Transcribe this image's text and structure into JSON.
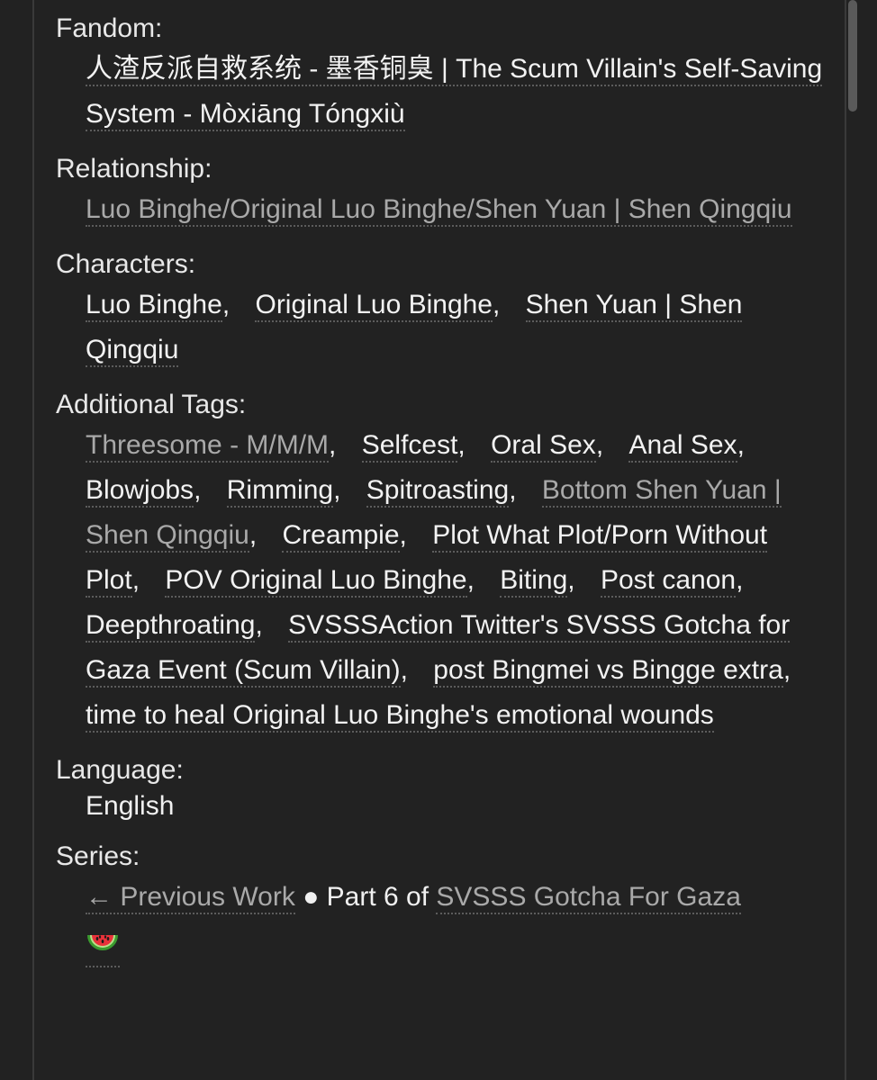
{
  "fandom": {
    "label": "Fandom:",
    "tags": [
      {
        "text": "人渣反派自救系统 - 墨香铜臭 | The Scum Villain's Self-Saving System - Mòxiāng Tóngxiù",
        "dim": false
      }
    ]
  },
  "relationship": {
    "label": "Relationship:",
    "tags": [
      {
        "text": "Luo Binghe/Original Luo Binghe/Shen Yuan | Shen Qingqiu",
        "dim": true
      }
    ]
  },
  "characters": {
    "label": "Characters:",
    "tags": [
      {
        "text": "Luo Binghe",
        "dim": false
      },
      {
        "text": "Original Luo Binghe",
        "dim": false
      },
      {
        "text": "Shen Yuan | Shen Qingqiu",
        "dim": false
      }
    ]
  },
  "additional_tags": {
    "label": "Additional Tags:",
    "tags": [
      {
        "text": "Threesome - M/M/M",
        "dim": true
      },
      {
        "text": "Selfcest",
        "dim": false
      },
      {
        "text": "Oral Sex",
        "dim": false
      },
      {
        "text": "Anal Sex",
        "dim": false
      },
      {
        "text": "Blowjobs",
        "dim": false
      },
      {
        "text": "Rimming",
        "dim": false
      },
      {
        "text": "Spitroasting",
        "dim": false
      },
      {
        "text": "Bottom Shen Yuan | Shen Qingqiu",
        "dim": true
      },
      {
        "text": "Creampie",
        "dim": false
      },
      {
        "text": "Plot What Plot/Porn Without Plot",
        "dim": false
      },
      {
        "text": "POV Original Luo Binghe",
        "dim": false
      },
      {
        "text": "Biting",
        "dim": false
      },
      {
        "text": "Post canon",
        "dim": false
      },
      {
        "text": "Deepthroating",
        "dim": false
      },
      {
        "text": "SVSSSAction Twitter's SVSSS Gotcha for Gaza Event (Scum Villain)",
        "dim": false
      },
      {
        "text": "post Bingmei vs Bingge extra",
        "dim": false
      },
      {
        "text": "time to heal Original Luo Binghe's emotional wounds",
        "dim": false
      }
    ]
  },
  "language": {
    "label": "Language:",
    "value": "English"
  },
  "series": {
    "label": "Series:",
    "previous_link": "← Previous Work",
    "bullet": "●",
    "part_text": "Part 6 of",
    "series_link": "SVSSS Gotcha For Gaza",
    "emoji_icon": "watermelon-icon"
  },
  "colors": {
    "background": "#222222",
    "text": "#f0f0f0",
    "dim_tag": "#a9a9a9",
    "underline": "#5c5c5c"
  }
}
